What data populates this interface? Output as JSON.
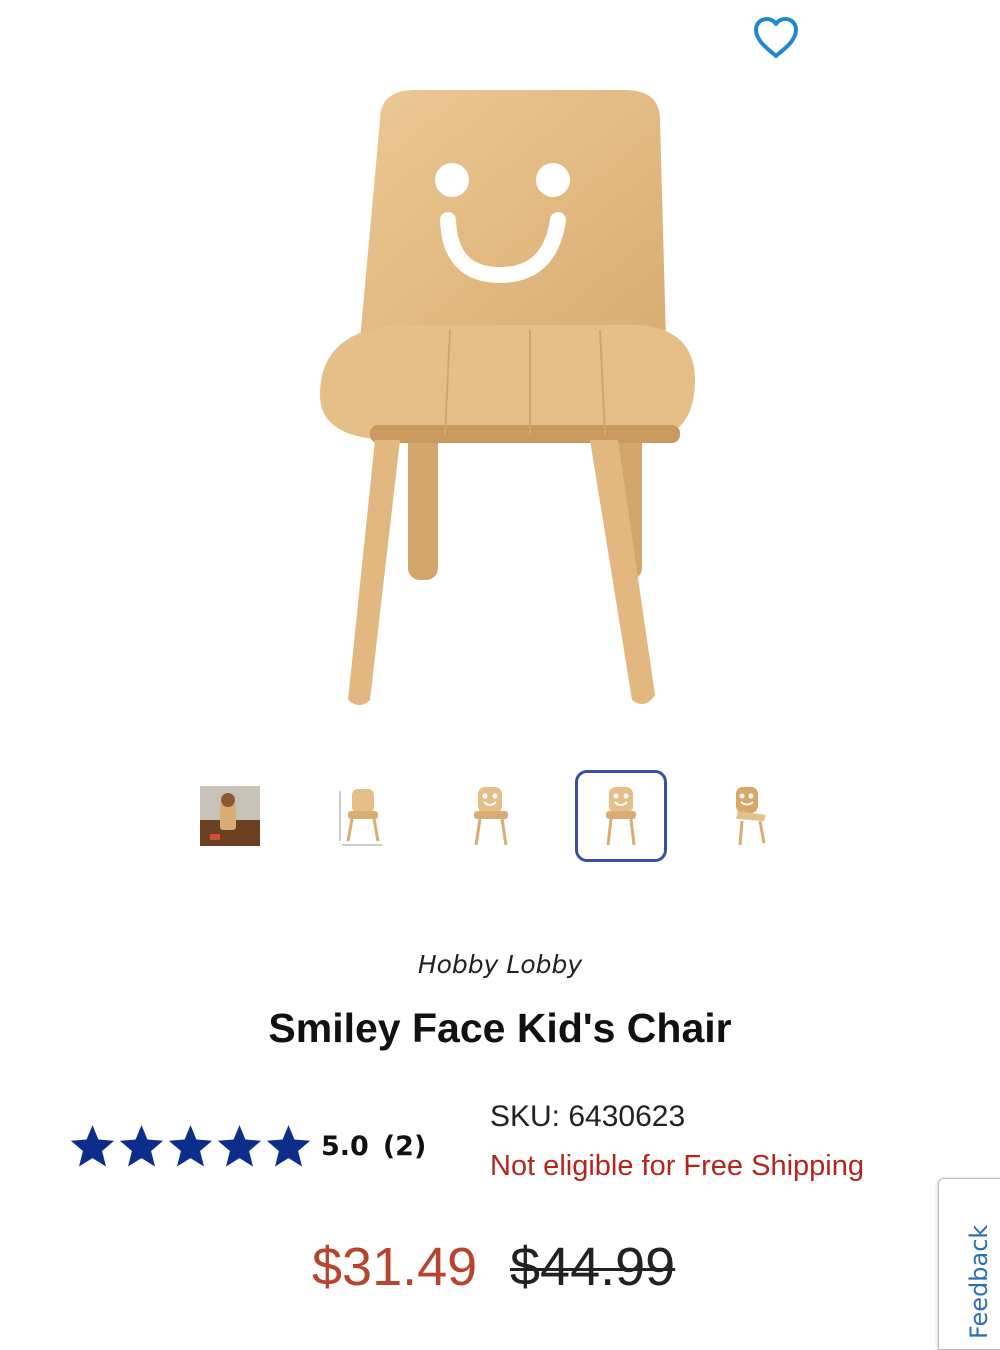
{
  "product": {
    "brand": "Hobby Lobby",
    "title": "Smiley Face Kid's Chair",
    "sku": "SKU: 6430623",
    "shipping_note": "Not eligible for Free Shipping",
    "price_sale": "$31.49",
    "price_original": "$44.99"
  },
  "rating": {
    "score": "5.0",
    "count": "(2)",
    "stars": 5
  },
  "gallery": {
    "thumbnail_count": 5,
    "active_index": 3
  },
  "feedback_label": "Feedback",
  "icons": {
    "favorite": "heart-outline-icon",
    "rating_star": "star-icon"
  },
  "colors": {
    "accent_blue": "#3a4fa3",
    "heart_blue": "#1e88d6",
    "star_navy": "#0d2d8a",
    "sale_red": "#b8432e",
    "warning_red": "#b3261e",
    "wood": "#e3bb86"
  }
}
